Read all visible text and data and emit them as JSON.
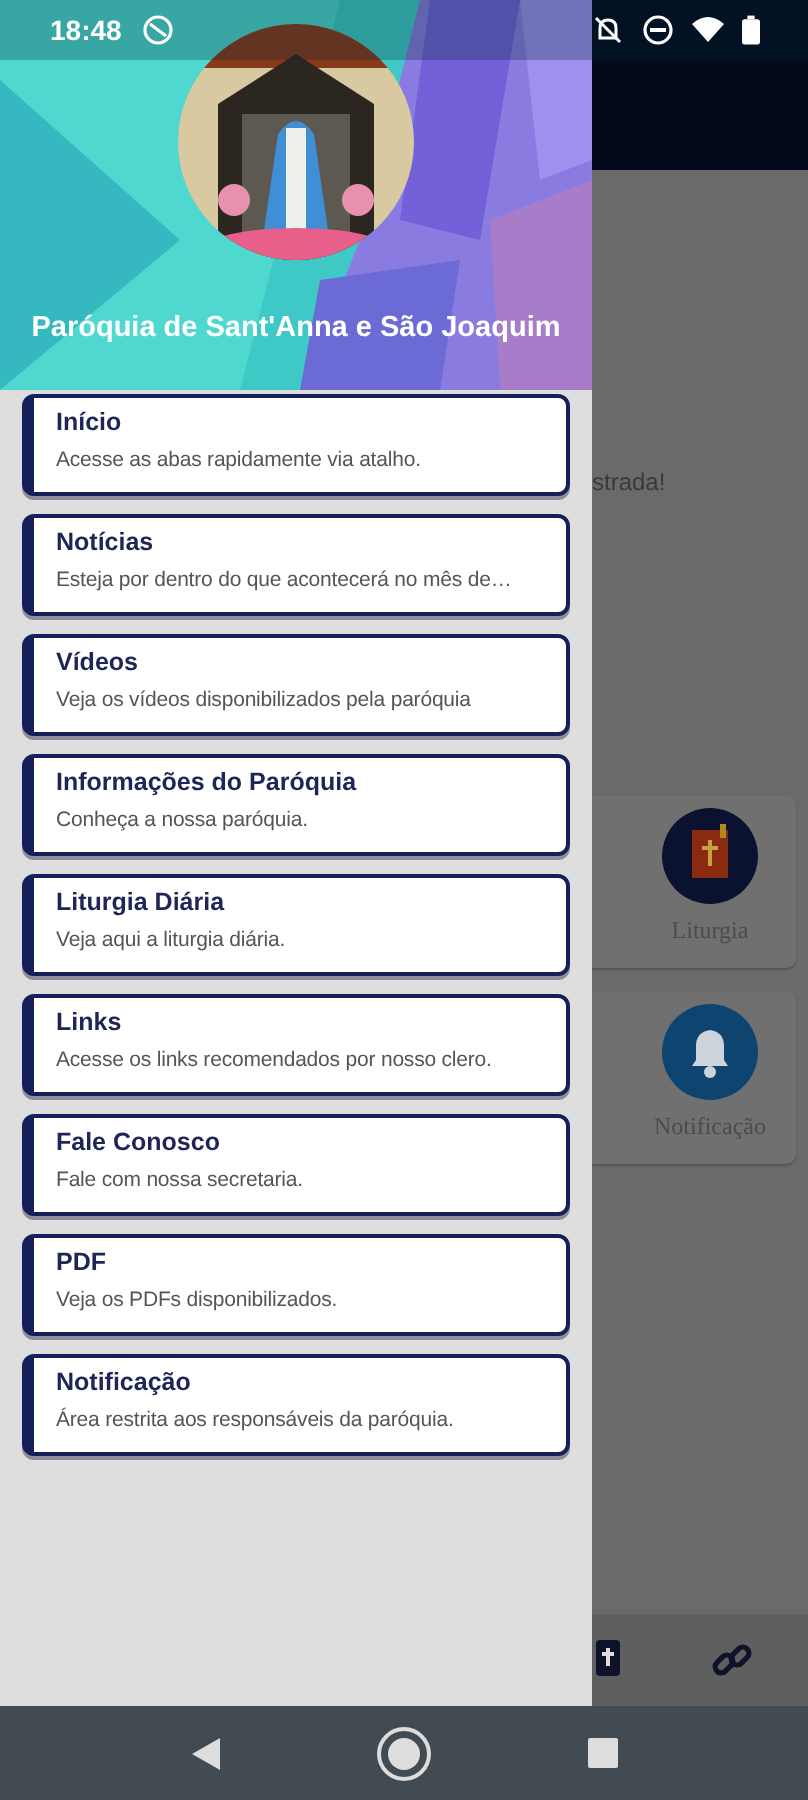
{
  "status_bar": {
    "time": "18:48"
  },
  "drawer": {
    "header": {
      "title": "Paróquia de Sant'Anna e São Joaquim"
    },
    "items": [
      {
        "title": "Início",
        "subtitle": "Acesse as abas rapidamente via atalho."
      },
      {
        "title": "Notícias",
        "subtitle": "Esteja por dentro do que acontecerá no mês de…"
      },
      {
        "title": "Vídeos",
        "subtitle": "Veja os vídeos disponibilizados pela paróquia"
      },
      {
        "title": "Informações do Paróquia",
        "subtitle": "Conheça a nossa paróquia."
      },
      {
        "title": "Liturgia Diária",
        "subtitle": "Veja aqui a liturgia diária."
      },
      {
        "title": "Links",
        "subtitle": "Acesse os links recomendados por nosso clero."
      },
      {
        "title": "Fale Conosco",
        "subtitle": "Fale com nossa secretaria."
      },
      {
        "title": "PDF",
        "subtitle": "Veja os PDFs disponibilizados."
      },
      {
        "title": "Notificação",
        "subtitle": "Área restrita aos responsáveis da paróquia."
      }
    ]
  },
  "background": {
    "text": "strada!",
    "cards": [
      {
        "label": "Liturgia",
        "kind": "book"
      },
      {
        "label": "Notificação",
        "kind": "bell"
      }
    ]
  }
}
